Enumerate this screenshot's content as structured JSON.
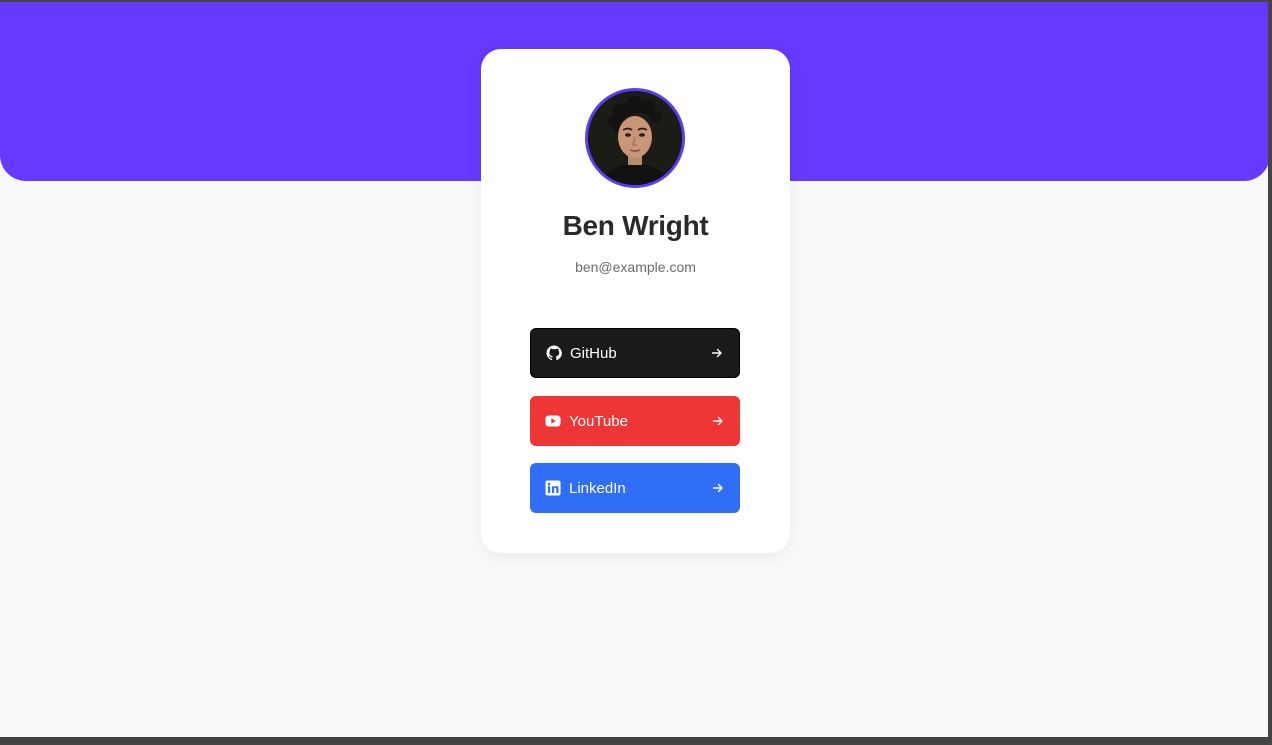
{
  "profile": {
    "name": "Ben Wright",
    "email": "ben@example.com"
  },
  "links": [
    {
      "label": "GitHub",
      "icon": "github-icon",
      "color": "#1a1a1a"
    },
    {
      "label": "YouTube",
      "icon": "youtube-icon",
      "color": "#ef3637"
    },
    {
      "label": "LinkedIn",
      "icon": "linkedin-icon",
      "color": "#2f6ef5"
    }
  ],
  "colors": {
    "accent": "#6639ff",
    "avatar_ring": "#5b3df5",
    "page_background": "#f9f9f9",
    "card_background": "#ffffff"
  }
}
